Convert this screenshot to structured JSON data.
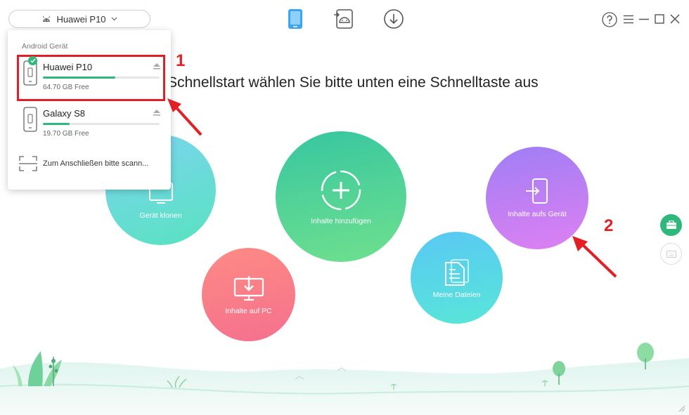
{
  "header": {
    "selected_device": "Huawei P10"
  },
  "headline": "Schnellstart wählen Sie bitte unten eine Schnelltaste aus",
  "actions": [
    {
      "label": "Gerät klonen"
    },
    {
      "label": "Inhalte hinzufügen"
    },
    {
      "label": "Inhalte aufs Gerät"
    },
    {
      "label": "Inhalte auf PC"
    },
    {
      "label": "Meine Dateien"
    }
  ],
  "dropdown": {
    "heading": "Android Gerät",
    "devices": [
      {
        "name": "Huawei P10",
        "free": "64.70 GB Free",
        "used_fraction": 0.62,
        "selected": true
      },
      {
        "name": "Galaxy S8",
        "free": "19.70 GB Free",
        "used_fraction": 0.23,
        "selected": false
      }
    ],
    "scan_label": "Zum Anschließen bitte scann..."
  },
  "annotations": {
    "step1": "1",
    "step2": "2"
  },
  "colors": {
    "accent_green": "#2fb87b",
    "highlight_red": "#e31e24",
    "phone_blue": "#3aa6f0"
  },
  "icons": [
    "android-icon",
    "chevron-down-icon",
    "phone-icon",
    "android-transfer-icon",
    "download-icon",
    "help-icon",
    "menu-icon",
    "minimize-icon",
    "maximize-icon",
    "close-icon",
    "eject-icon",
    "scan-icon",
    "toolbox-icon",
    "keyboard-icon"
  ]
}
